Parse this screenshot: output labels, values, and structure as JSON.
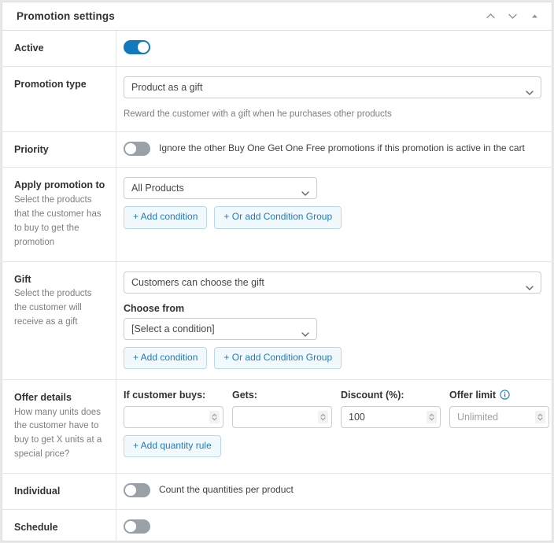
{
  "header": {
    "title": "Promotion settings",
    "icons": [
      {
        "name": "chevron-up-icon"
      },
      {
        "name": "chevron-down-icon"
      },
      {
        "name": "collapse-caret-icon"
      }
    ]
  },
  "rows": {
    "active": {
      "label": "Active",
      "toggle_state": "on"
    },
    "promotion_type": {
      "label": "Promotion type",
      "select_value": "Product as a gift",
      "help_text": "Reward the customer with a gift when he purchases other products"
    },
    "priority": {
      "label": "Priority",
      "toggle_state": "off",
      "toggle_text": "Ignore the other Buy One Get One Free promotions if this promotion is active in the cart"
    },
    "apply_promotion_to": {
      "label": "Apply promotion to",
      "description": "Select the products that the customer has to buy to get the promotion",
      "select_value": "All Products",
      "add_condition_label": "+ Add condition",
      "add_condition_group_label": "+ Or add Condition Group"
    },
    "gift": {
      "label": "Gift",
      "description": "Select the products the customer will receive as a gift",
      "select_value": "Customers can choose the gift",
      "choose_from_label": "Choose from",
      "choose_from_value": "[Select a condition]",
      "add_condition_label": "+ Add condition",
      "add_condition_group_label": "+ Or add Condition Group"
    },
    "offer_details": {
      "label": "Offer details",
      "description": "How many units does the customer have to buy to get X units at a special price?",
      "columns": [
        {
          "head": "If customer buys:",
          "value": "",
          "placeholder": "",
          "info": false
        },
        {
          "head": "Gets:",
          "value": "",
          "placeholder": "",
          "info": false
        },
        {
          "head": "Discount (%):",
          "value": "100",
          "placeholder": "",
          "info": false
        },
        {
          "head": "Offer limit",
          "value": "",
          "placeholder": "Unlimited",
          "info": true
        }
      ],
      "add_quantity_rule_label": "+ Add quantity rule"
    },
    "individual": {
      "label": "Individual",
      "toggle_state": "off",
      "toggle_text": "Count the quantities per product"
    },
    "schedule": {
      "label": "Schedule",
      "toggle_state": "off"
    }
  },
  "colors": {
    "accent": "#1379bf",
    "toggle_off": "#98a0a8",
    "border": "#e4e4e5",
    "link": "#2279c0"
  }
}
